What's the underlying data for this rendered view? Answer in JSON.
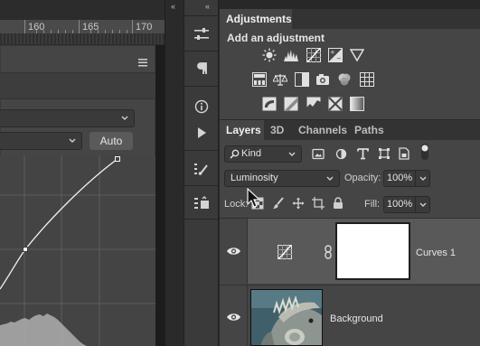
{
  "ruler": {
    "labels": [
      "160",
      "165",
      "170"
    ]
  },
  "properties": {
    "auto_label": "Auto"
  },
  "adjustments": {
    "tab_label": "Adjustments",
    "subtitle": "Add an adjustment",
    "icons_row1": [
      "brightness-contrast-icon",
      "levels-icon",
      "curves-icon",
      "exposure-icon",
      "vibrance-icon"
    ],
    "icons_row2": [
      "hue-saturation-icon",
      "color-balance-icon",
      "black-white-icon",
      "photo-filter-icon",
      "channel-mixer-icon",
      "color-lookup-icon"
    ],
    "icons_row3": [
      "invert-icon",
      "posterize-icon",
      "threshold-icon",
      "selective-color-icon",
      "gradient-map-icon"
    ]
  },
  "layers": {
    "tabs": [
      "Layers",
      "3D",
      "Channels",
      "Paths"
    ],
    "kind_value": "Kind",
    "blend_mode": "Luminosity",
    "opacity_label": "Opacity:",
    "opacity_value": "100%",
    "lock_label": "Lock:",
    "fill_label": "Fill:",
    "fill_value": "100%",
    "items": [
      {
        "name": "Curves 1",
        "type": "adjustment"
      },
      {
        "name": "Background",
        "type": "image"
      }
    ]
  },
  "colors": {
    "panel_bg": "#454545",
    "selected_row": "#595959",
    "tab_bar": "#333333"
  }
}
